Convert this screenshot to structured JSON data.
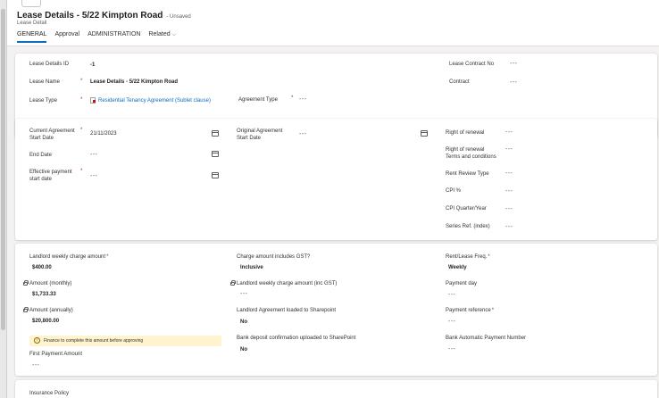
{
  "header": {
    "title": "Lease Details - 5/22 Kimpton Road",
    "unsaved": "- Unsaved",
    "subtitle": "Lease Detail"
  },
  "tabs": [
    {
      "label": "GENERAL",
      "active": true
    },
    {
      "label": "Approval"
    },
    {
      "label": "ADMINISTRATION"
    },
    {
      "label": "Related"
    }
  ],
  "card1": {
    "lease_details_id": {
      "label": "Lease Details ID",
      "value": "-1"
    },
    "lease_name": {
      "label": "Lease Name",
      "value": "Lease Details - 5/22 Kimpton Road"
    },
    "lease_type": {
      "label": "Lease Type",
      "value": "Residential Tenancy Agreement (Sublet clause)"
    },
    "agreement_type": {
      "label": "Agreement Type",
      "value": "---"
    },
    "lease_contract_no": {
      "label": "Lease Contract No",
      "value": "---"
    },
    "contract": {
      "label": "Contract",
      "value": "---"
    }
  },
  "card2": {
    "current_start_l1": "Current Agreement",
    "current_start_l2": "Start Date",
    "current_start_value": "21/11/2023",
    "end_date": {
      "label": "End Date",
      "value": "---"
    },
    "effective_l1": "Effective payment",
    "effective_l2": "start date",
    "effective_value": "---",
    "original_l1": "Original Agreement",
    "original_l2": "Start Date",
    "original_value": "---",
    "right_of_renewal": {
      "label": "Right of renewal",
      "value": "---"
    },
    "renewal_terms_l1": "Right of renewal",
    "renewal_terms_l2": "Terms and conditions",
    "renewal_terms_value": "---",
    "rent_review_type": {
      "label": "Rent Review Type",
      "value": "---"
    },
    "cpi_pct": {
      "label": "CPI %",
      "value": "---"
    },
    "cpi_quarter": {
      "label": "CPI Quarter/Year",
      "value": "---"
    },
    "series_ref": {
      "label": "Series Ref. (index)",
      "value": "---"
    }
  },
  "card3": {
    "landlord_weekly": {
      "label": "Landlord weekly charge amount",
      "value": "$400.00"
    },
    "amount_monthly": {
      "label": "Amount (monthly)",
      "value": "$1,733.33"
    },
    "amount_annually": {
      "label": "Amount (annually)",
      "value": "$20,800.00"
    },
    "warning": "Finance to complete this amount before approving",
    "first_payment": {
      "label": "First Payment Amount",
      "value": "---"
    },
    "charge_gst": {
      "label": "Charge amount includes GST?",
      "value": "Inclusive"
    },
    "landlord_weekly_gst": {
      "label": "Landlord weekly charge amount (inc GST)",
      "value": "---"
    },
    "landlord_sharepoint": {
      "label": "Landlord Agreement loaded to Sharepoint",
      "value": "No"
    },
    "bank_deposit": {
      "label": "Bank deposit confirmation uploaded to SharePoint",
      "value": "No"
    },
    "rent_freq": {
      "label": "Rent/Lease Freq.",
      "value": "Weekly"
    },
    "payment_day": {
      "label": "Payment day",
      "value": "---"
    },
    "payment_ref": {
      "label": "Payment reference",
      "value": "---"
    },
    "bank_auto": {
      "label": "Bank Automatic Payment Number",
      "value": "---"
    }
  },
  "card4": {
    "insurance_policy": "Insurance Policy"
  },
  "colors": {
    "accent": "#0f6cbd",
    "required": "#a4262c",
    "warning_bg": "#fff4ce"
  }
}
